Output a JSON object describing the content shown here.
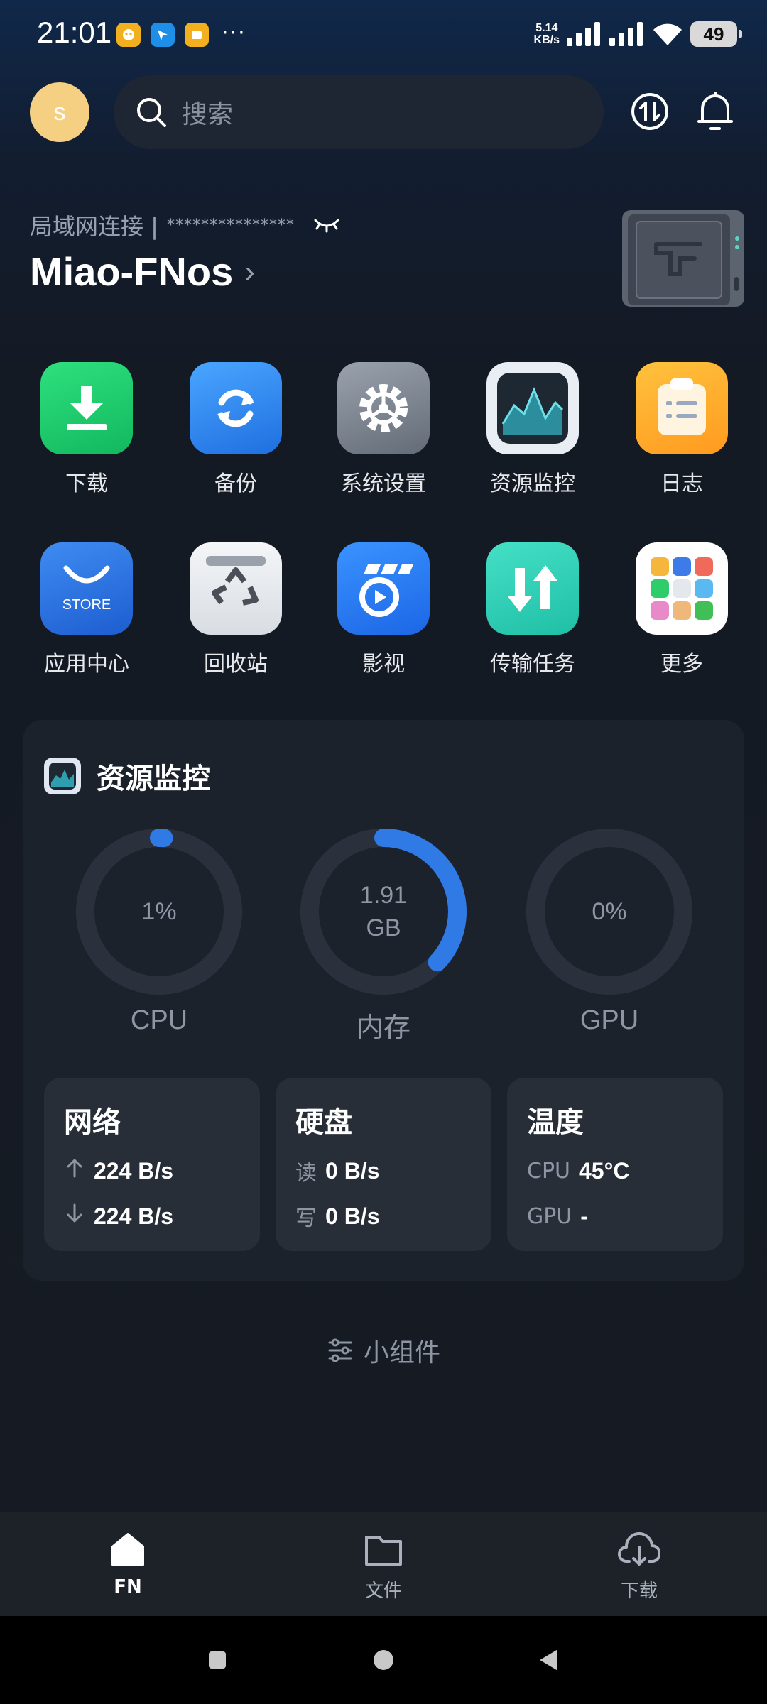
{
  "status_bar": {
    "time": "21:01",
    "net_speed_value": "5.14",
    "net_speed_unit": "KB/s",
    "more": "···",
    "battery": "49"
  },
  "header": {
    "avatar_initial": "s",
    "search_placeholder": "搜索"
  },
  "device": {
    "connection_label": "局域网连接 |",
    "masked_address": "***************",
    "name": "Miao-FNos"
  },
  "apps": [
    {
      "label": "下载",
      "icon": "download-icon"
    },
    {
      "label": "备份",
      "icon": "backup-sync-icon"
    },
    {
      "label": "系统设置",
      "icon": "gear-icon"
    },
    {
      "label": "资源监控",
      "icon": "monitor-chart-icon"
    },
    {
      "label": "日志",
      "icon": "clipboard-log-icon"
    },
    {
      "label": "应用中心",
      "icon": "store-bag-icon",
      "badge_text": "STORE"
    },
    {
      "label": "回收站",
      "icon": "recycle-bin-icon"
    },
    {
      "label": "影视",
      "icon": "video-player-icon"
    },
    {
      "label": "传输任务",
      "icon": "transfer-arrows-icon"
    },
    {
      "label": "更多",
      "icon": "app-grid-icon"
    }
  ],
  "resource_monitor": {
    "title": "资源监控",
    "gauges": [
      {
        "label": "CPU",
        "value_line1": "1%",
        "value_line2": "",
        "percent": 1
      },
      {
        "label": "内存",
        "value_line1": "1.91",
        "value_line2": "GB",
        "percent": 37
      },
      {
        "label": "GPU",
        "value_line1": "0%",
        "value_line2": "",
        "percent": 0
      }
    ],
    "network": {
      "title": "网络",
      "up": "224 B/s",
      "down": "224 B/s"
    },
    "disk": {
      "title": "硬盘",
      "read_label": "读",
      "read": "0 B/s",
      "write_label": "写",
      "write": "0 B/s"
    },
    "temperature": {
      "title": "温度",
      "cpu_label": "CPU",
      "cpu": "45°C",
      "gpu_label": "GPU",
      "gpu": "-"
    }
  },
  "widgets_label": "小组件",
  "tabs": [
    {
      "label": "FN",
      "active": true
    },
    {
      "label": "文件",
      "active": false
    },
    {
      "label": "下载",
      "active": false
    }
  ],
  "colors": {
    "accent": "#2f7ae5",
    "card": "#1c222c",
    "subcard": "#282e38",
    "avatar": "#f5cf82"
  }
}
